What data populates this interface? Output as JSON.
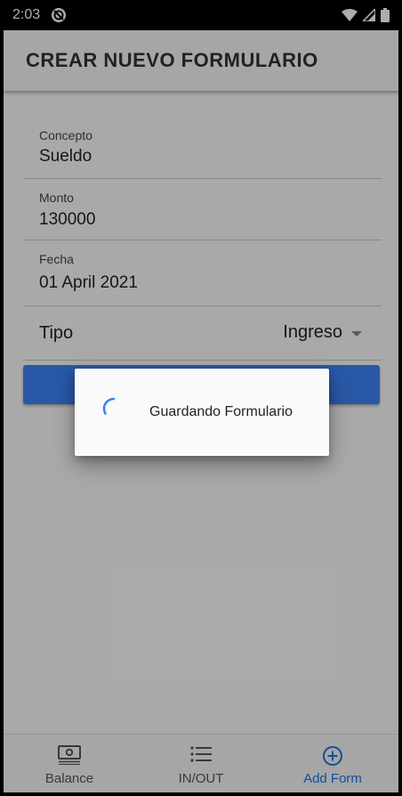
{
  "status_bar": {
    "time": "2:03",
    "icons": [
      "app-notification-icon",
      "wifi-icon",
      "signal-icon",
      "battery-icon"
    ]
  },
  "appbar": {
    "title": "CREAR NUEVO FORMULARIO"
  },
  "form": {
    "concepto": {
      "label": "Concepto",
      "value": "Sueldo"
    },
    "monto": {
      "label": "Monto",
      "value": "130000"
    },
    "fecha": {
      "label": "Fecha",
      "value": "01 April 2021"
    },
    "tipo": {
      "label": "Tipo",
      "value": "Ingreso"
    }
  },
  "dialog": {
    "message": "Guardando Formulario"
  },
  "bottom_nav": {
    "items": [
      {
        "label": "Balance",
        "icon": "money-icon",
        "active": false
      },
      {
        "label": "IN/OUT",
        "icon": "list-icon",
        "active": false
      },
      {
        "label": "Add Form",
        "icon": "add-circle-icon",
        "active": true
      }
    ]
  },
  "colors": {
    "accent": "#3b82f6",
    "active_nav": "#1a73e8",
    "scrim": "rgba(0,0,0,0.32)"
  }
}
